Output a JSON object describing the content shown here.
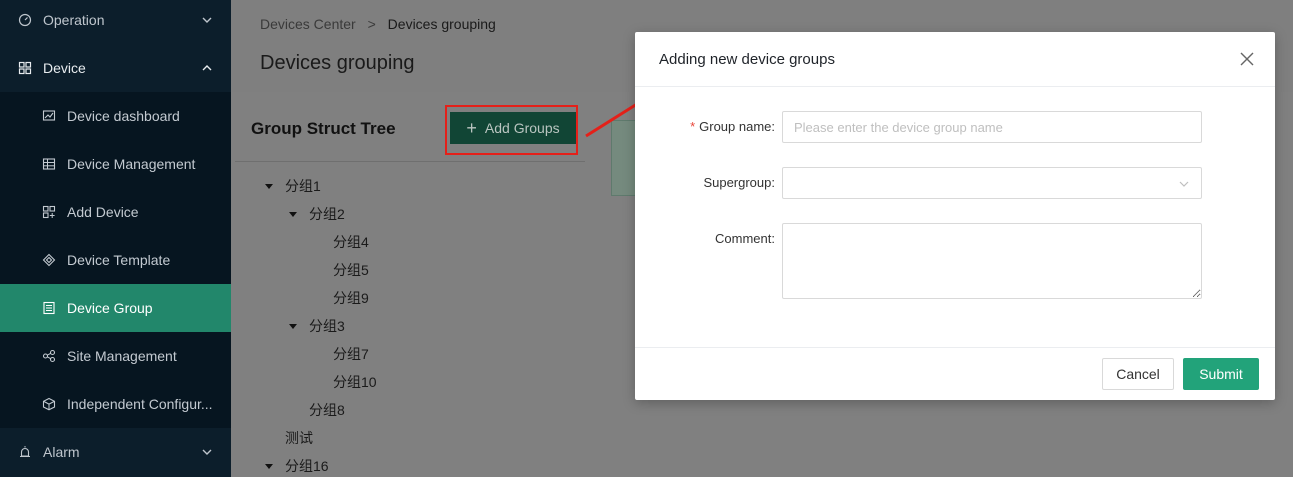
{
  "sidebar": {
    "items": [
      {
        "label": "Operation",
        "icon": "dashboard-icon",
        "expanded": false
      },
      {
        "label": "Device",
        "icon": "device-icon",
        "expanded": true
      },
      {
        "label": "Device dashboard",
        "icon": "chart-icon"
      },
      {
        "label": "Device Management",
        "icon": "table-icon"
      },
      {
        "label": "Add Device",
        "icon": "add-device-icon"
      },
      {
        "label": "Device Template",
        "icon": "template-icon"
      },
      {
        "label": "Device Group",
        "icon": "group-icon",
        "active": true
      },
      {
        "label": "Site Management",
        "icon": "site-icon"
      },
      {
        "label": "Independent Configur...",
        "icon": "cube-icon"
      },
      {
        "label": "Alarm",
        "icon": "alarm-icon",
        "expanded": false
      }
    ]
  },
  "breadcrumb": {
    "root": "Devices Center",
    "separator": ">",
    "current": "Devices grouping"
  },
  "page": {
    "title": "Devices grouping"
  },
  "tree_panel": {
    "title": "Group Struct Tree",
    "add_button": "Add Groups",
    "nodes": [
      {
        "label": "分组1",
        "expanded": true
      },
      {
        "label": "分组2",
        "expanded": true
      },
      {
        "label": "分组4"
      },
      {
        "label": "分组5"
      },
      {
        "label": "分组9"
      },
      {
        "label": "分组3",
        "expanded": true
      },
      {
        "label": "分组7"
      },
      {
        "label": "分组10"
      },
      {
        "label": "分组8"
      },
      {
        "label": "测试"
      },
      {
        "label": "分组16",
        "expanded": true
      }
    ]
  },
  "modal": {
    "title": "Adding new device groups",
    "required_mark": "*",
    "fields": {
      "group_name": {
        "label": "Group name:",
        "placeholder": "Please enter the device group name",
        "value": ""
      },
      "supergroup": {
        "label": "Supergroup:",
        "value": ""
      },
      "comment": {
        "label": "Comment:",
        "value": ""
      }
    },
    "cancel_label": "Cancel",
    "submit_label": "Submit"
  },
  "colors": {
    "sidebar_bg": "#0c1e2b",
    "sidebar_active": "#22876b",
    "primary": "#22a37a",
    "annotation": "#e52019"
  }
}
